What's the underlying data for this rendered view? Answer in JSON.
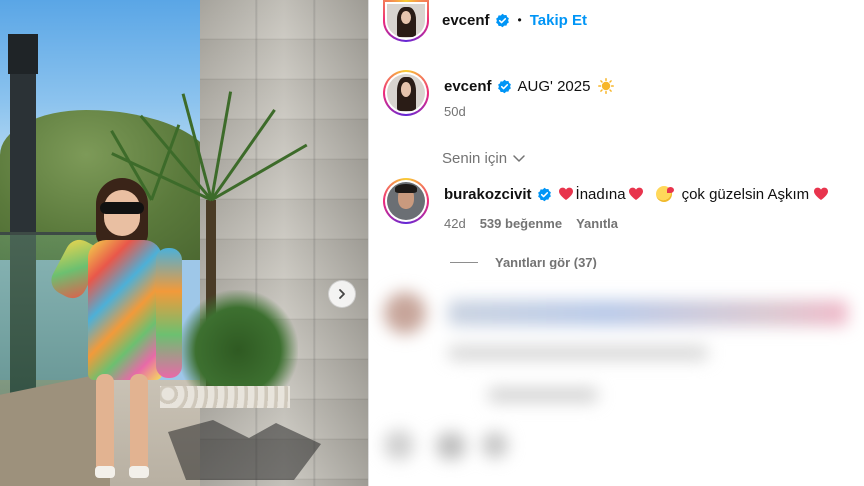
{
  "post": {
    "username": "evcenf",
    "separator": "•",
    "follow_label": "Takip Et",
    "caption": "AUG' 2025",
    "posted_ago": "50d"
  },
  "sort": {
    "label": "Senin için"
  },
  "comment": {
    "username": "burakozcivit",
    "text_part1": "İnadına",
    "text_part2": "çok güzelsin Aşkım",
    "age": "42d",
    "likes": "539 beğenme",
    "reply_label": "Yanıtla",
    "view_replies": "Yanıtları gör (37)"
  },
  "icons": {
    "verified": "verified-badge-icon",
    "sun": "sun-emoji-icon",
    "heart": "red-heart-emoji-icon",
    "kiss": "face-blowing-kiss-emoji-icon",
    "chevron": "chevron-down-icon",
    "next": "chevron-right-icon"
  },
  "colors": {
    "follow_blue": "#0095f6",
    "verified_blue": "#0095f6",
    "muted": "#737373",
    "heart_red": "#e8344d"
  }
}
